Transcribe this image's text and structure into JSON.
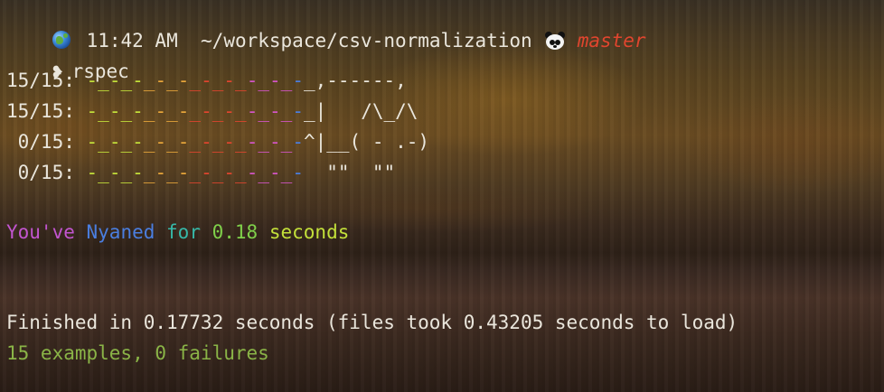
{
  "status_bar": {
    "time": "11:42 AM",
    "path": "~/workspace/csv-normalization",
    "branch": "master"
  },
  "prompt": {
    "symbol": "❥",
    "command": "rspec"
  },
  "nyan_rows": [
    {
      "count": "15/15:",
      "trail": "-_-_-_-_-_-_-_-_-_-",
      "cat": "_,------,"
    },
    {
      "count": "15/15:",
      "trail": "-_-_-_-_-_-_-_-_-_-",
      "cat": "_|   /\\_/\\"
    },
    {
      "count": " 0/15:",
      "trail": "-_-_-_-_-_-_-_-_-_-",
      "cat": "^|__( - .-)"
    },
    {
      "count": " 0/15:",
      "trail": "-_-_-_-_-_-_-_-_-_-",
      "cat": "  \"\"  \"\""
    }
  ],
  "nyan_summary": {
    "w1": "You've",
    "w2": "Nyaned",
    "w3": "for",
    "w4": "0.18",
    "w5": "seconds"
  },
  "finished_text": "Finished in 0.17732 seconds (files took 0.43205 seconds to load)",
  "result_text": "15 examples, 0 failures",
  "colors": {
    "text": "#eae6dc",
    "branch": "#e0452e",
    "success": "#8ab447",
    "rainbow": [
      "#c3e03a",
      "#e8a63a",
      "#e0452e",
      "#d455c8",
      "#4a7ee0",
      "#36b8a8"
    ]
  },
  "icons": [
    "globe-icon",
    "panda-icon",
    "prompt-arrow-icon"
  ]
}
